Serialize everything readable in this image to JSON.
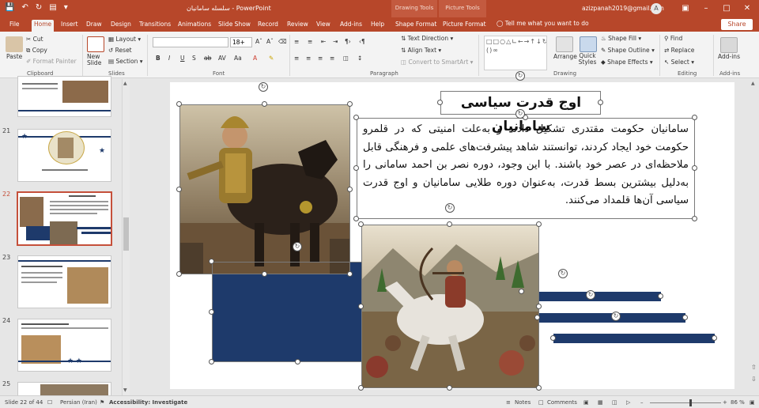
{
  "titlebar": {
    "doc_title": "سلسله سامانیان - PowerPoint",
    "ctx_drawing": "Drawing Tools",
    "ctx_picture": "Picture Tools",
    "account": "azizpanah2019@gmail.com",
    "avatar_letter": "A"
  },
  "tabs": [
    "File",
    "Home",
    "Insert",
    "Draw",
    "Design",
    "Transitions",
    "Animations",
    "Slide Show",
    "Record",
    "Review",
    "View",
    "Add-ins",
    "Help",
    "Shape Format",
    "Picture Format"
  ],
  "tell_me": "Tell me what you want to do",
  "share": "Share",
  "ribbon": {
    "paste": "Paste",
    "cut": "Cut",
    "copy": "Copy",
    "format_painter": "Format Painter",
    "clipboard": "Clipboard",
    "new_slide": "New Slide",
    "layout": "Layout",
    "reset": "Reset",
    "section": "Section",
    "slides": "Slides",
    "font_size": "18+",
    "font": "Font",
    "text_direction": "Text Direction",
    "align_text": "Align Text",
    "convert_smartart": "Convert to SmartArt",
    "paragraph": "Paragraph",
    "arrange": "Arrange",
    "quick_styles": "Quick Styles",
    "shape_fill": "Shape Fill",
    "shape_outline": "Shape Outline",
    "shape_effects": "Shape Effects",
    "drawing": "Drawing",
    "find": "Find",
    "replace": "Replace",
    "select": "Select",
    "editing": "Editing",
    "addins": "Add-ins",
    "addins_group": "Add-ins"
  },
  "thumbnails": [
    {
      "num": "21"
    },
    {
      "num": "22"
    },
    {
      "num": "23"
    },
    {
      "num": "24"
    },
    {
      "num": "25"
    }
  ],
  "slide": {
    "title": "اوج قدرت سیاسی سامانیان",
    "body": "سامانیان حکومت مقتدری تشکیل دادند و به‌علت امنیتی که در قلمرو حکومت خود ایجاد کردند، توانستند شاهد پیشرفت‌های علمی و فرهنگی قابل ملاحظه‌ای در عصر خود باشند. با این وجود، دوره نصر بن احمد سامانی را به‌دلیل بیشترین بسط قدرت، به‌عنوان دوره طلایی سامانیان و اوج قدرت سیاسی آن‌ها قلمداد می‌کنند."
  },
  "status": {
    "slide_info": "Slide 22 of 44",
    "language": "Persian (Iran)",
    "accessibility": "Accessibility: Investigate",
    "notes": "Notes",
    "comments": "Comments",
    "zoom": "86 %"
  }
}
